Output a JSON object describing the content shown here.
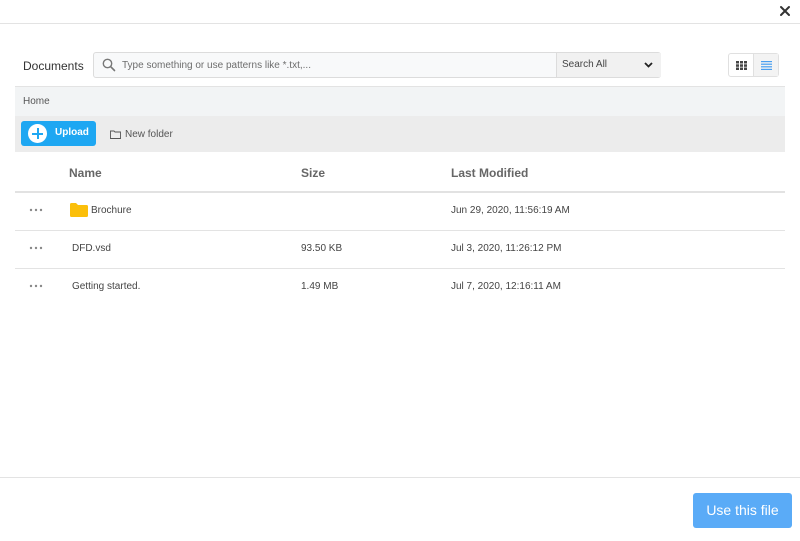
{
  "dialog": {
    "close_icon": "close-icon"
  },
  "search": {
    "label": "Documents",
    "placeholder": "Type something or use patterns like *.txt,...",
    "value": "",
    "scope_selected": "Search All",
    "icon": "search-icon"
  },
  "view_toggle": {
    "grid_icon": "grid-view-icon",
    "list_icon": "list-view-icon",
    "active": "list",
    "active_color": "#4a9ff0"
  },
  "breadcrumb": {
    "items": [
      "Home"
    ]
  },
  "toolbar": {
    "upload_label": "Upload",
    "new_folder_label": "New folder",
    "upload_color": "#1ea7f2"
  },
  "table": {
    "columns": [
      "Name",
      "Size",
      "Last Modified"
    ],
    "rows": [
      {
        "type": "folder",
        "name": "Brochure",
        "size": "",
        "modified": "Jun 29, 2020, 11:56:19 AM"
      },
      {
        "type": "file",
        "name": "DFD.vsd",
        "size": "93.50 KB",
        "modified": "Jul 3, 2020, 11:26:12 PM"
      },
      {
        "type": "file",
        "name": "Getting started.",
        "size": "1.49 MB",
        "modified": "Jul 7, 2020, 12:16:11 AM"
      }
    ]
  },
  "footer": {
    "use_file_label": "Use this file",
    "button_color": "#5aabf7"
  }
}
